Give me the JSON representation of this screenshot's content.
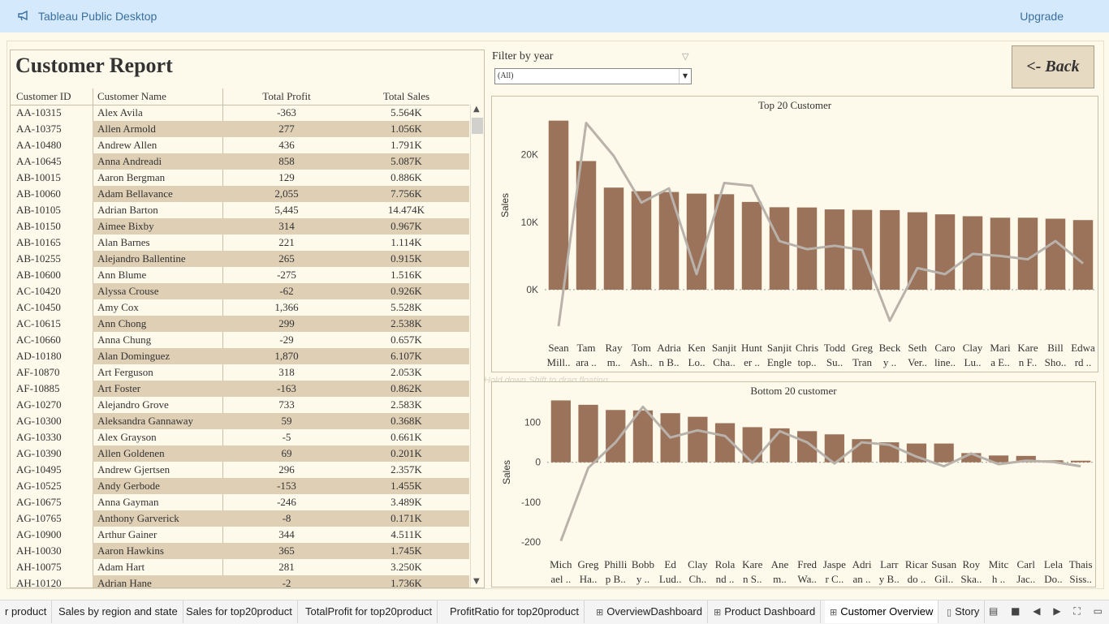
{
  "topbar": {
    "app_title": "Tableau Public Desktop",
    "upgrade": "Upgrade"
  },
  "report": {
    "title": "Customer Report",
    "columns": [
      "Customer ID",
      "Customer Name",
      "Total Profit",
      "Total Sales"
    ],
    "rows": [
      [
        "AA-10315",
        "Alex Avila",
        "-363",
        "5.564K"
      ],
      [
        "AA-10375",
        "Allen Armold",
        "277",
        "1.056K"
      ],
      [
        "AA-10480",
        "Andrew Allen",
        "436",
        "1.791K"
      ],
      [
        "AA-10645",
        "Anna Andreadi",
        "858",
        "5.087K"
      ],
      [
        "AB-10015",
        "Aaron Bergman",
        "129",
        "0.886K"
      ],
      [
        "AB-10060",
        "Adam Bellavance",
        "2,055",
        "7.756K"
      ],
      [
        "AB-10105",
        "Adrian Barton",
        "5,445",
        "14.474K"
      ],
      [
        "AB-10150",
        "Aimee Bixby",
        "314",
        "0.967K"
      ],
      [
        "AB-10165",
        "Alan Barnes",
        "221",
        "1.114K"
      ],
      [
        "AB-10255",
        "Alejandro Ballentine",
        "265",
        "0.915K"
      ],
      [
        "AB-10600",
        "Ann Blume",
        "-275",
        "1.516K"
      ],
      [
        "AC-10420",
        "Alyssa Crouse",
        "-62",
        "0.926K"
      ],
      [
        "AC-10450",
        "Amy Cox",
        "1,366",
        "5.528K"
      ],
      [
        "AC-10615",
        "Ann Chong",
        "299",
        "2.538K"
      ],
      [
        "AC-10660",
        "Anna Chung",
        "-29",
        "0.657K"
      ],
      [
        "AD-10180",
        "Alan Dominguez",
        "1,870",
        "6.107K"
      ],
      [
        "AF-10870",
        "Art Ferguson",
        "318",
        "2.053K"
      ],
      [
        "AF-10885",
        "Art Foster",
        "-163",
        "0.862K"
      ],
      [
        "AG-10270",
        "Alejandro Grove",
        "733",
        "2.583K"
      ],
      [
        "AG-10300",
        "Aleksandra Gannaway",
        "59",
        "0.368K"
      ],
      [
        "AG-10330",
        "Alex Grayson",
        "-5",
        "0.661K"
      ],
      [
        "AG-10390",
        "Allen Goldenen",
        "69",
        "0.201K"
      ],
      [
        "AG-10495",
        "Andrew Gjertsen",
        "296",
        "2.357K"
      ],
      [
        "AG-10525",
        "Andy Gerbode",
        "-153",
        "1.455K"
      ],
      [
        "AG-10675",
        "Anna Gayman",
        "-246",
        "3.489K"
      ],
      [
        "AG-10765",
        "Anthony Garverick",
        "-8",
        "0.171K"
      ],
      [
        "AG-10900",
        "Arthur Gainer",
        "344",
        "4.511K"
      ],
      [
        "AH-10030",
        "Aaron Hawkins",
        "365",
        "1.745K"
      ],
      [
        "AH-10075",
        "Adam Hart",
        "281",
        "3.250K"
      ],
      [
        "AH-10120",
        "Adrian Hane",
        "-2",
        "1.736K"
      ]
    ]
  },
  "filter": {
    "label": "Filter by year",
    "value": "(All)"
  },
  "back_button": "<- Back",
  "drag_hint": "Hold down Shift to drag floating",
  "chart_data": [
    {
      "type": "bar",
      "title": "Top 20 Customer",
      "ylabel": "Sales",
      "ylim": [
        0,
        25000
      ],
      "yticks": [
        0,
        10000,
        20000
      ],
      "ytick_labels": [
        "0K",
        "10K",
        "20K"
      ],
      "categories": [
        [
          "Sean",
          "Mill.."
        ],
        [
          "Tam",
          "ara .."
        ],
        [
          "Ray",
          "m.."
        ],
        [
          "Tom",
          "Ash.."
        ],
        [
          "Adria",
          "n B.."
        ],
        [
          "Ken",
          "Lo.."
        ],
        [
          "Sanjit",
          "Cha.."
        ],
        [
          "Hunt",
          "er .."
        ],
        [
          "Sanjit",
          "Engle"
        ],
        [
          "Chris",
          "top.."
        ],
        [
          "Todd",
          "Su.."
        ],
        [
          "Greg",
          "Tran"
        ],
        [
          "Beck",
          "y .."
        ],
        [
          "Seth",
          "Ver.."
        ],
        [
          "Caro",
          "line.."
        ],
        [
          "Clay",
          "Lu.."
        ],
        [
          "Mari",
          "a E.."
        ],
        [
          "Kare",
          "n F.."
        ],
        [
          "Bill",
          "Sho.."
        ],
        [
          "Edwa",
          "rd .."
        ]
      ],
      "series": [
        {
          "values": [
            25040,
            19050,
            15120,
            14590,
            14470,
            14230,
            14140,
            13000,
            12210,
            12180,
            11890,
            11820,
            11790,
            11470,
            11160,
            10880,
            10660,
            10660,
            10520,
            10310
          ],
          "color": "#9b735b"
        },
        {
          "kind": "line",
          "values": [
            -5400,
            24700,
            19800,
            12900,
            15000,
            2300,
            15800,
            15400,
            7200,
            6000,
            6500,
            5900,
            -4600,
            3200,
            2300,
            5300,
            5000,
            4500,
            7200,
            3900
          ],
          "color": "#b9b2ab"
        }
      ]
    },
    {
      "type": "bar",
      "title": "Bottom 20 customer",
      "ylabel": "Sales",
      "ylim": [
        -210,
        160
      ],
      "yticks": [
        -200,
        -100,
        0,
        100
      ],
      "ytick_labels": [
        "-200",
        "-100",
        "0",
        "100"
      ],
      "categories": [
        [
          "Mich",
          "ael .."
        ],
        [
          "Greg",
          "Ha.."
        ],
        [
          "Philli",
          "p B.."
        ],
        [
          "Bobb",
          "y .."
        ],
        [
          "Ed",
          "Lud.."
        ],
        [
          "Clay",
          "Ch.."
        ],
        [
          "Rola",
          "nd .."
        ],
        [
          "Kare",
          "n S.."
        ],
        [
          "Ane",
          "m.."
        ],
        [
          "Fred",
          "Wa.."
        ],
        [
          "Jaspe",
          "r C.."
        ],
        [
          "Adri",
          "an .."
        ],
        [
          "Larr",
          "y B.."
        ],
        [
          "Ricar",
          "do .."
        ],
        [
          "Susan",
          "Gil.."
        ],
        [
          "Roy",
          "Ska.."
        ],
        [
          "Mitc",
          "h .."
        ],
        [
          "Carl",
          "Jac.."
        ],
        [
          "Lela",
          "Do.."
        ],
        [
          "Thais",
          "Siss.."
        ]
      ],
      "series": [
        {
          "values": [
            155,
            144,
            131,
            130,
            123,
            114,
            98,
            88,
            85,
            78,
            70,
            58,
            50,
            47,
            47,
            23,
            17,
            16,
            5,
            4
          ],
          "color": "#9b735b"
        },
        {
          "kind": "line",
          "values": [
            -197,
            -14,
            50,
            139,
            62,
            80,
            66,
            -1,
            78,
            50,
            -3,
            50,
            44,
            14,
            -10,
            22,
            -5,
            4,
            1,
            -10
          ],
          "color": "#b9b2ab"
        }
      ]
    }
  ],
  "tabs": [
    {
      "label": "r product"
    },
    {
      "label": "Sales by region and state"
    },
    {
      "label": "Sales for top20product"
    },
    {
      "label": "TotalProfit for top20product"
    },
    {
      "label": "ProfitRatio for top20product"
    },
    {
      "label": "OverviewDashboard",
      "icon": "dashboard-icon"
    },
    {
      "label": "Product Dashboard",
      "icon": "dashboard-icon"
    },
    {
      "label": "Customer Overview",
      "icon": "dashboard-icon",
      "active": true
    },
    {
      "label": "Story",
      "icon": "story-icon"
    }
  ]
}
